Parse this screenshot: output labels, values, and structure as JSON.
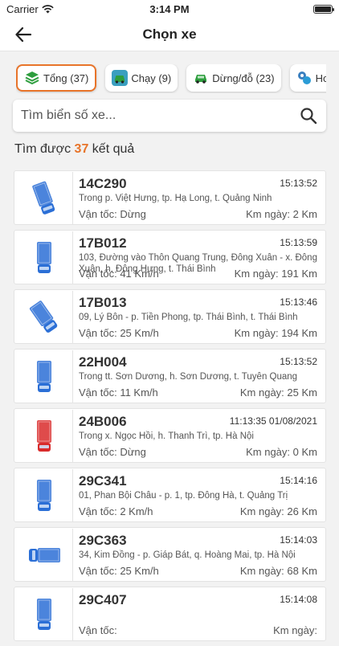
{
  "status": {
    "carrier": "Carrier",
    "time": "3:14 PM"
  },
  "nav": {
    "title": "Chọn xe"
  },
  "filters": [
    {
      "label": "Tổng (37)",
      "icon": "layers-icon",
      "color": "#2e9e3e",
      "active": true
    },
    {
      "label": "Chạy (9)",
      "icon": "car-moving-icon",
      "color": "#3a9fbf",
      "active": false
    },
    {
      "label": "Dừng/đỗ (23)",
      "icon": "car-parked-icon",
      "color": "#2e9e3e",
      "active": false
    },
    {
      "label": "Hoạt đ",
      "icon": "activity-icon",
      "color": "#3a7fbf",
      "active": false
    }
  ],
  "search": {
    "placeholder": "Tìm biển số xe..."
  },
  "result": {
    "prefix": "Tìm được",
    "count": "37",
    "suffix": "kết quả"
  },
  "labels": {
    "speed": "Vận tốc:",
    "km": "Km ngày:"
  },
  "vehicles": [
    {
      "plate": "14C290",
      "time": "15:13:52",
      "address": "Trong p. Việt Hưng, tp. Hạ Long, t. Quảng Ninh",
      "speed": "Dừng",
      "km": "2 Km",
      "icon": "truck-blue-icon",
      "color": "#2b6fd6"
    },
    {
      "plate": "17B012",
      "time": "15:13:59",
      "address": "103, Đường vào Thôn Quang Trung, Đông Xuân - x. Đông Xuân, h. Đông Hưng, t. Thái Bình",
      "speed": "41 Km/h",
      "km": "191 Km",
      "icon": "truck-blue-icon",
      "color": "#2b6fd6"
    },
    {
      "plate": "17B013",
      "time": "15:13:46",
      "address": "09, Lý Bôn - p. Tiền Phong, tp. Thái Bình, t. Thái Bình",
      "speed": "25 Km/h",
      "km": "194 Km",
      "icon": "truck-blue-icon",
      "color": "#2b6fd6"
    },
    {
      "plate": "22H004",
      "time": "15:13:52",
      "address": "Trong tt. Sơn Dương, h. Sơn Dương, t. Tuyên Quang",
      "speed": "11 Km/h",
      "km": "25 Km",
      "icon": "truck-blue-icon",
      "color": "#2b6fd6"
    },
    {
      "plate": "24B006",
      "time": "11:13:35 01/08/2021",
      "address": "Trong x. Ngọc Hồi, h. Thanh Trì, tp. Hà Nội",
      "speed": "Dừng",
      "km": "0 Km",
      "icon": "truck-red-icon",
      "color": "#d92b2b"
    },
    {
      "plate": "29C341",
      "time": "15:14:16",
      "address": "01, Phan Bội Châu - p. 1, tp. Đông Hà, t. Quảng Trị",
      "speed": "2 Km/h",
      "km": "26 Km",
      "icon": "truck-blue-icon",
      "color": "#2b6fd6"
    },
    {
      "plate": "29C363",
      "time": "15:14:03",
      "address": "34, Kim Đồng - p. Giáp Bát, q. Hoàng Mai, tp. Hà Nội",
      "speed": "25 Km/h",
      "km": "68 Km",
      "icon": "truck-blue-icon",
      "color": "#2b6fd6"
    },
    {
      "plate": "29C407",
      "time": "15:14:08",
      "address": "",
      "speed": "",
      "km": "",
      "icon": "truck-blue-icon",
      "color": "#2b6fd6"
    }
  ]
}
